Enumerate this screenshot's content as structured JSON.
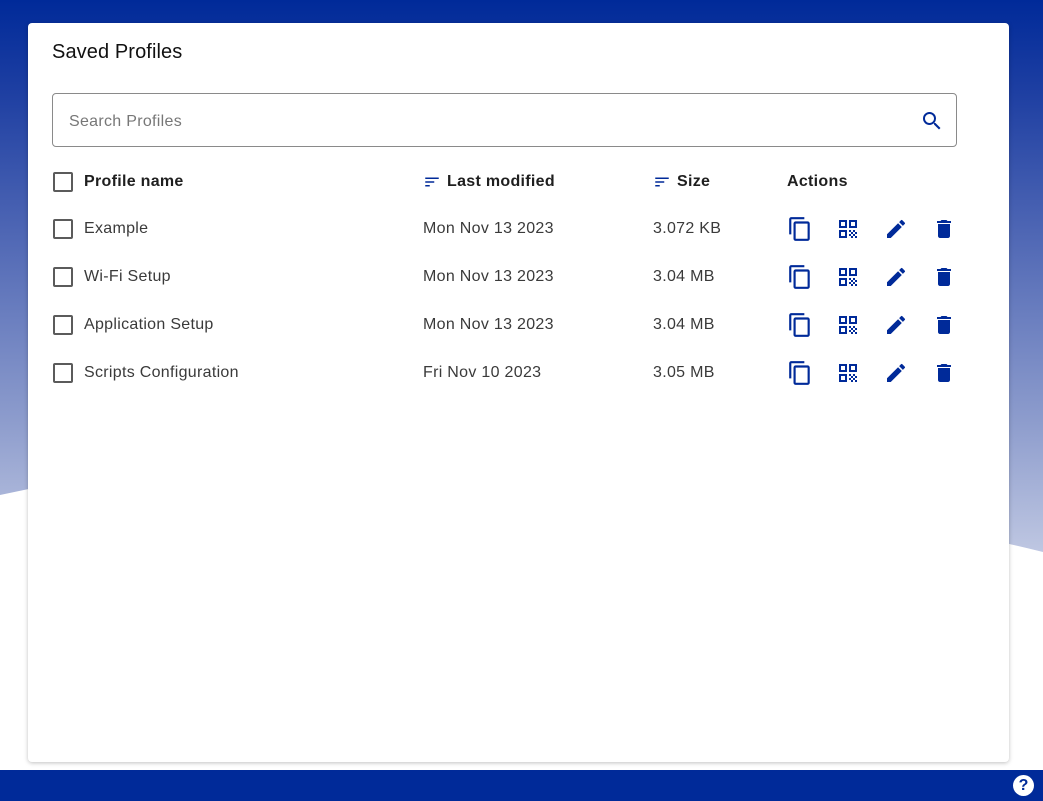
{
  "colors": {
    "brand": "#002a99",
    "icon": "#002a99",
    "text": "#3a3a3a"
  },
  "title": "Saved Profiles",
  "search": {
    "placeholder": "Search Profiles",
    "value": "",
    "icon": "search-icon"
  },
  "table": {
    "headers": {
      "name": "Profile name",
      "modified": "Last modified",
      "size": "Size",
      "actions": "Actions"
    },
    "rows": [
      {
        "name": "Example",
        "modified": "Mon Nov 13 2023",
        "size": "3.072 KB"
      },
      {
        "name": "Wi-Fi Setup",
        "modified": "Mon Nov 13 2023",
        "size": "3.04 MB"
      },
      {
        "name": "Application Setup",
        "modified": "Mon Nov 13 2023",
        "size": "3.04 MB"
      },
      {
        "name": "Scripts Configuration",
        "modified": "Fri Nov 10 2023",
        "size": "3.05 MB"
      }
    ],
    "action_icons": [
      "copy-icon",
      "qr-code-icon",
      "edit-icon",
      "delete-icon"
    ]
  },
  "help": {
    "label": "?",
    "icon": "help-icon"
  }
}
